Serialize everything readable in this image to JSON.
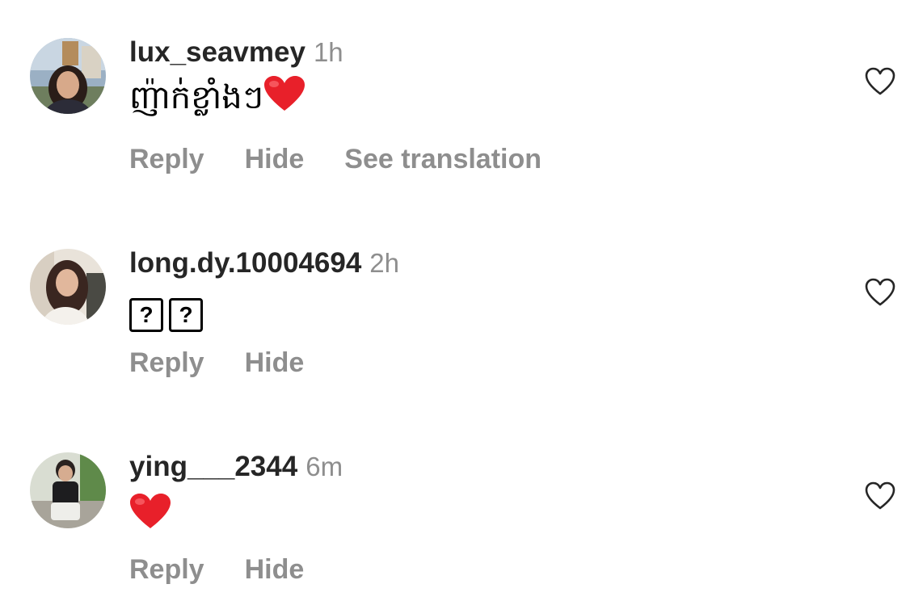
{
  "comments": [
    {
      "username": "lux_seavmey",
      "time": "1h",
      "text": "ញ៉ាក់ខ្លាំងៗ",
      "emoji": "red-heart",
      "actions": [
        "Reply",
        "Hide",
        "See translation"
      ]
    },
    {
      "username": "long.dy.10004694",
      "time": "2h",
      "boxes": [
        "?",
        "?"
      ],
      "actions": [
        "Reply",
        "Hide"
      ]
    },
    {
      "username": "ying___2344",
      "time": "6m",
      "emoji": "red-heart",
      "actions": [
        "Reply",
        "Hide"
      ]
    }
  ],
  "icons": {
    "like": "heart-outline-icon",
    "emoji": "red-heart-emoji"
  },
  "colors": {
    "username": "#262626",
    "meta": "#8e8e8e",
    "heart_emoji": "#e8202a"
  }
}
